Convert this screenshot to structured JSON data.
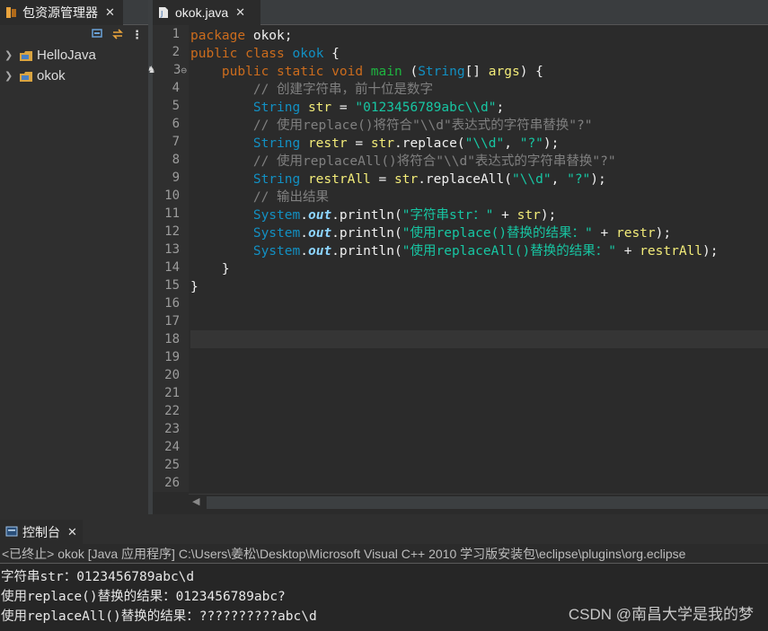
{
  "explorer": {
    "tab_label": "包资源管理器",
    "close_glyph": "✕",
    "toolbar": {
      "collapse_icon": "collapse-all-icon",
      "link_icon": "link-editor-icon",
      "menu_glyph": "⋮"
    },
    "projects": [
      {
        "label": "HelloJava"
      },
      {
        "label": "okok"
      }
    ]
  },
  "editor": {
    "tab_label": "okok.java",
    "close_glyph": "✕",
    "line_numbers": [
      "1",
      "2",
      "3",
      "4",
      "5",
      "6",
      "7",
      "8",
      "9",
      "10",
      "11",
      "12",
      "13",
      "14",
      "15",
      "16",
      "17",
      "18",
      "19",
      "20",
      "21",
      "22",
      "23",
      "24",
      "25",
      "26"
    ],
    "fold_marker_line": "3",
    "current_line": 18,
    "lines": [
      [
        {
          "t": "package ",
          "c": "kw"
        },
        {
          "t": "okok;",
          "c": "id"
        }
      ],
      [
        {
          "t": "public ",
          "c": "kw"
        },
        {
          "t": "class ",
          "c": "kw"
        },
        {
          "t": "okok ",
          "c": "cls"
        },
        {
          "t": "{",
          "c": "id"
        }
      ],
      [
        {
          "t": "    public ",
          "c": "kw"
        },
        {
          "t": "static ",
          "c": "kw"
        },
        {
          "t": "void ",
          "c": "kw"
        },
        {
          "t": "main ",
          "c": "method-decl"
        },
        {
          "t": "(",
          "c": "id"
        },
        {
          "t": "String",
          "c": "type"
        },
        {
          "t": "[] ",
          "c": "id"
        },
        {
          "t": "args",
          "c": "var"
        },
        {
          "t": ") {",
          "c": "id"
        }
      ],
      [
        {
          "t": "        // 创建字符串，前十位是数字",
          "c": "cm"
        }
      ],
      [
        {
          "t": "        ",
          "c": "id"
        },
        {
          "t": "String ",
          "c": "type"
        },
        {
          "t": "str",
          "c": "var"
        },
        {
          "t": " = ",
          "c": "id"
        },
        {
          "t": "\"0123456789abc\\\\d\"",
          "c": "str"
        },
        {
          "t": ";",
          "c": "id"
        }
      ],
      [
        {
          "t": "        // 使用replace()将符合\"\\\\d\"表达式的字符串替换\"?\"",
          "c": "cm"
        }
      ],
      [
        {
          "t": "        ",
          "c": "id"
        },
        {
          "t": "String ",
          "c": "type"
        },
        {
          "t": "restr",
          "c": "var"
        },
        {
          "t": " = ",
          "c": "id"
        },
        {
          "t": "str",
          "c": "var"
        },
        {
          "t": ".replace(",
          "c": "id"
        },
        {
          "t": "\"\\\\d\"",
          "c": "str"
        },
        {
          "t": ", ",
          "c": "id"
        },
        {
          "t": "\"?\"",
          "c": "str"
        },
        {
          "t": ");",
          "c": "id"
        }
      ],
      [
        {
          "t": "        // 使用replaceAll()将符合\"\\\\d\"表达式的字符串替换\"?\"",
          "c": "cm"
        }
      ],
      [
        {
          "t": "        ",
          "c": "id"
        },
        {
          "t": "String ",
          "c": "type"
        },
        {
          "t": "restrAll",
          "c": "var"
        },
        {
          "t": " = ",
          "c": "id"
        },
        {
          "t": "str",
          "c": "var"
        },
        {
          "t": ".replaceAll(",
          "c": "id"
        },
        {
          "t": "\"\\\\d\"",
          "c": "str"
        },
        {
          "t": ", ",
          "c": "id"
        },
        {
          "t": "\"?\"",
          "c": "str"
        },
        {
          "t": ");",
          "c": "id"
        }
      ],
      [
        {
          "t": "        // 输出结果",
          "c": "cm"
        }
      ],
      [
        {
          "t": "        ",
          "c": "id"
        },
        {
          "t": "System",
          "c": "type"
        },
        {
          "t": ".",
          "c": "id"
        },
        {
          "t": "out",
          "c": "field"
        },
        {
          "t": ".println(",
          "c": "id"
        },
        {
          "t": "\"字符串str：\"",
          "c": "str"
        },
        {
          "t": " + ",
          "c": "id"
        },
        {
          "t": "str",
          "c": "var"
        },
        {
          "t": ");",
          "c": "id"
        }
      ],
      [
        {
          "t": "        ",
          "c": "id"
        },
        {
          "t": "System",
          "c": "type"
        },
        {
          "t": ".",
          "c": "id"
        },
        {
          "t": "out",
          "c": "field"
        },
        {
          "t": ".println(",
          "c": "id"
        },
        {
          "t": "\"使用replace()替换的结果：\"",
          "c": "str"
        },
        {
          "t": " + ",
          "c": "id"
        },
        {
          "t": "restr",
          "c": "var"
        },
        {
          "t": ");",
          "c": "id"
        }
      ],
      [
        {
          "t": "        ",
          "c": "id"
        },
        {
          "t": "System",
          "c": "type"
        },
        {
          "t": ".",
          "c": "id"
        },
        {
          "t": "out",
          "c": "field"
        },
        {
          "t": ".println(",
          "c": "id"
        },
        {
          "t": "\"使用replaceAll()替换的结果：\"",
          "c": "str"
        },
        {
          "t": " + ",
          "c": "id"
        },
        {
          "t": "restrAll",
          "c": "var"
        },
        {
          "t": ");",
          "c": "id"
        }
      ],
      [
        {
          "t": "    }",
          "c": "id"
        }
      ],
      [
        {
          "t": "}",
          "c": "id"
        }
      ]
    ]
  },
  "console": {
    "tab_label": "控制台",
    "close_glyph": "✕",
    "status": "<已终止> okok [Java 应用程序] C:\\Users\\姜松\\Desktop\\Microsoft Visual C++ 2010 学习版安装包\\eclipse\\plugins\\org.eclipse",
    "output": [
      "字符串str：0123456789abc\\d",
      "使用replace()替换的结果：0123456789abc?",
      "使用replaceAll()替换的结果：??????????abc\\d"
    ]
  },
  "watermark": "CSDN @南昌大学是我的梦",
  "colors": {
    "keyword": "#cc6c1d",
    "type": "#1290c3",
    "string": "#17c6a3",
    "comment": "#808080",
    "variable": "#f3ec79",
    "background": "#2b2b2b"
  }
}
